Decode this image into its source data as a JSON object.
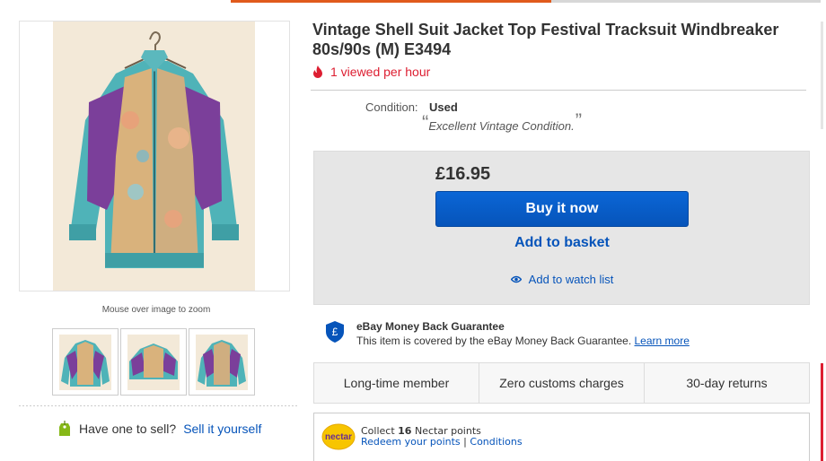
{
  "listing": {
    "title": "Vintage Shell Suit Jacket Top Festival Tracksuit Windbreaker 80s/90s (M) E3494",
    "views": "1 viewed per hour",
    "condition_label": "Condition:",
    "condition_value": "Used",
    "condition_description": "Excellent Vintage Condition.",
    "quote_open": "“",
    "quote_close": "”"
  },
  "gallery": {
    "zoom_hint": "Mouse over image to zoom",
    "thumbnail_count": 3
  },
  "sell": {
    "question": "Have one to sell?",
    "link": "Sell it yourself"
  },
  "purchase": {
    "price": "£16.95",
    "buy_now": "Buy it now",
    "add_to_basket": "Add to basket",
    "watch_list": "Add to watch list"
  },
  "guarantee": {
    "title": "eBay Money Back Guarantee",
    "text": "This item is covered by the eBay Money Back Guarantee.",
    "link": "Learn more"
  },
  "features": [
    "Long-time member",
    "Zero customs charges",
    "30-day returns"
  ],
  "nectar": {
    "logo_text": "nectar",
    "collect_prefix": "Collect",
    "points": "16",
    "collect_suffix": "Nectar points",
    "redeem": "Redeem your points",
    "separator": "|",
    "conditions": "Conditions"
  },
  "colors": {
    "link": "#0654ba",
    "buy_button": "#0654ba",
    "alert_red": "#dd1e31",
    "panel_grey": "#e6e6e6"
  },
  "icons": [
    "flame-icon",
    "eye-icon",
    "shield-pound-icon",
    "price-tag-icon",
    "nectar-logo"
  ]
}
